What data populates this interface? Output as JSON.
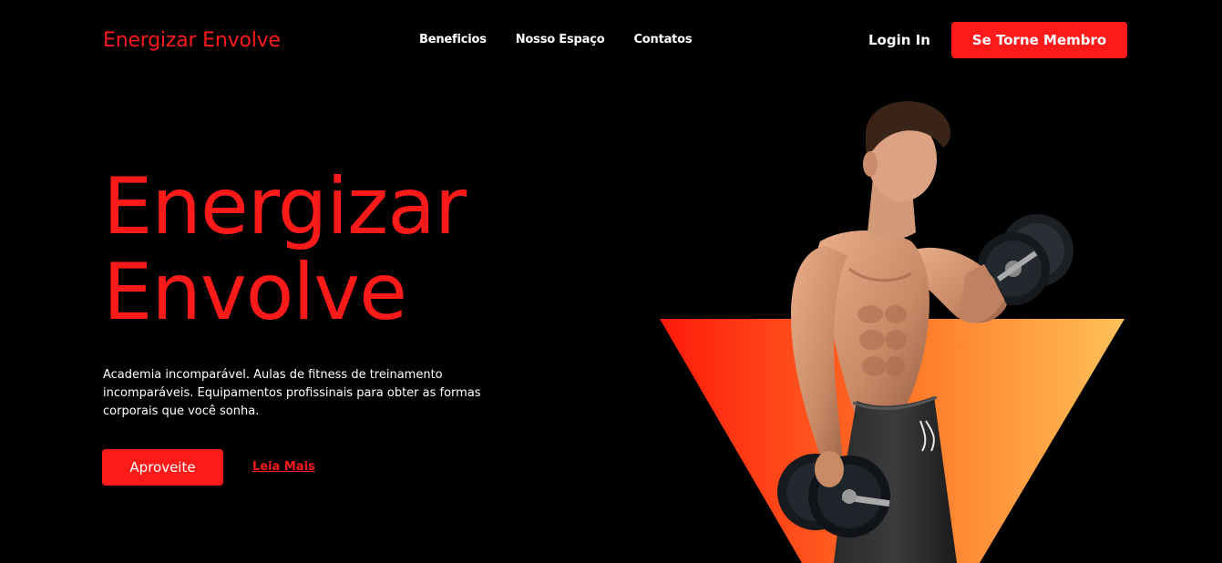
{
  "header": {
    "logo": "Energizar Envolve",
    "nav": [
      {
        "label": "Beneficios"
      },
      {
        "label": "Nosso Espaço"
      },
      {
        "label": "Contatos"
      }
    ],
    "login_label": "Login In",
    "join_label": "Se Torne Membro"
  },
  "hero": {
    "title_line1": "Energizar",
    "title_line2": "Envolve",
    "description": "Academia incomparável. Aulas de fitness de treinamento incomparáveis. Equipamentos profissinais para obter as formas corporais que você sonha.",
    "cta_label": "Aproveite",
    "more_label": "Leia Mais",
    "image": "athlete-with-dumbbells"
  },
  "colors": {
    "background": "#000000",
    "accent": "#ff1a1a",
    "gradient_start": "#ff1a0a",
    "gradient_end": "#ffc05a"
  }
}
